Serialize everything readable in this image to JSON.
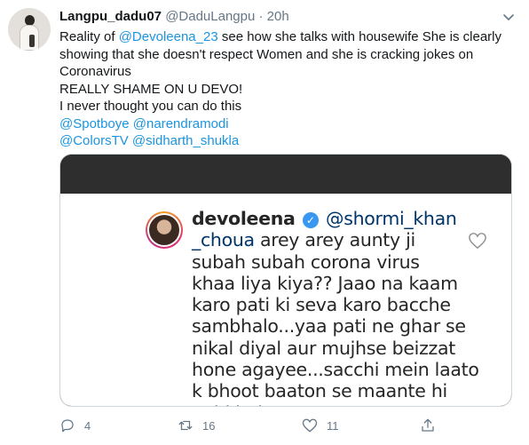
{
  "tweet": {
    "author_name": "Langpu_dadu07",
    "author_handle": "@DaduLangpu",
    "separator": "·",
    "time": "20h",
    "text_lines": [
      [
        {
          "t": "Reality of "
        },
        {
          "t": "@Devoleena_23",
          "m": true
        },
        {
          "t": " see how she talks with housewife  She is clearly"
        }
      ],
      [
        {
          "t": "showing that she doesn't respect Women and she is cracking jokes on"
        }
      ],
      [
        {
          "t": "Coronavirus"
        }
      ],
      [
        {
          "t": "REALLY SHAME ON U DEVO!"
        }
      ],
      [
        {
          "t": " I never thought you can do this"
        }
      ],
      [
        {
          "t": "@Spotboye",
          "m": true
        },
        {
          "t": " "
        },
        {
          "t": "@narendramodi",
          "m": true
        }
      ],
      [
        {
          "t": "@ColorsTV",
          "m": true
        },
        {
          "t": " "
        },
        {
          "t": "@sidharth_shukla",
          "m": true
        }
      ]
    ]
  },
  "screenshot": {
    "username": "devoleena",
    "verified_glyph": "✓",
    "first_line_mention": "@shormi_khan",
    "second_line_mention": "_choua",
    "second_line_rest": " arey arey aunty ji",
    "lines": [
      "subah subah corona virus",
      "khaa liya kiya?? Jaao na kaam",
      "karo pati ki seva karo bacche",
      "sambhalo...yaa pati ne ghar se",
      "nikal diyal aur mujhse beizzat",
      "hone agayee...sacchi mein laato",
      "k bhoot baaton se maante hi",
      "nahi hai"
    ],
    "like_icon": "heart-outline-icon"
  },
  "actions": {
    "reply_count": "4",
    "retweet_count": "16",
    "like_count": "11",
    "icons": [
      "reply-icon",
      "retweet-icon",
      "like-icon",
      "share-icon"
    ]
  },
  "colors": {
    "mention": "#1b95e0",
    "meta": "#657786",
    "dark_band": "#2e2e2e",
    "verified": "#3897f0"
  }
}
